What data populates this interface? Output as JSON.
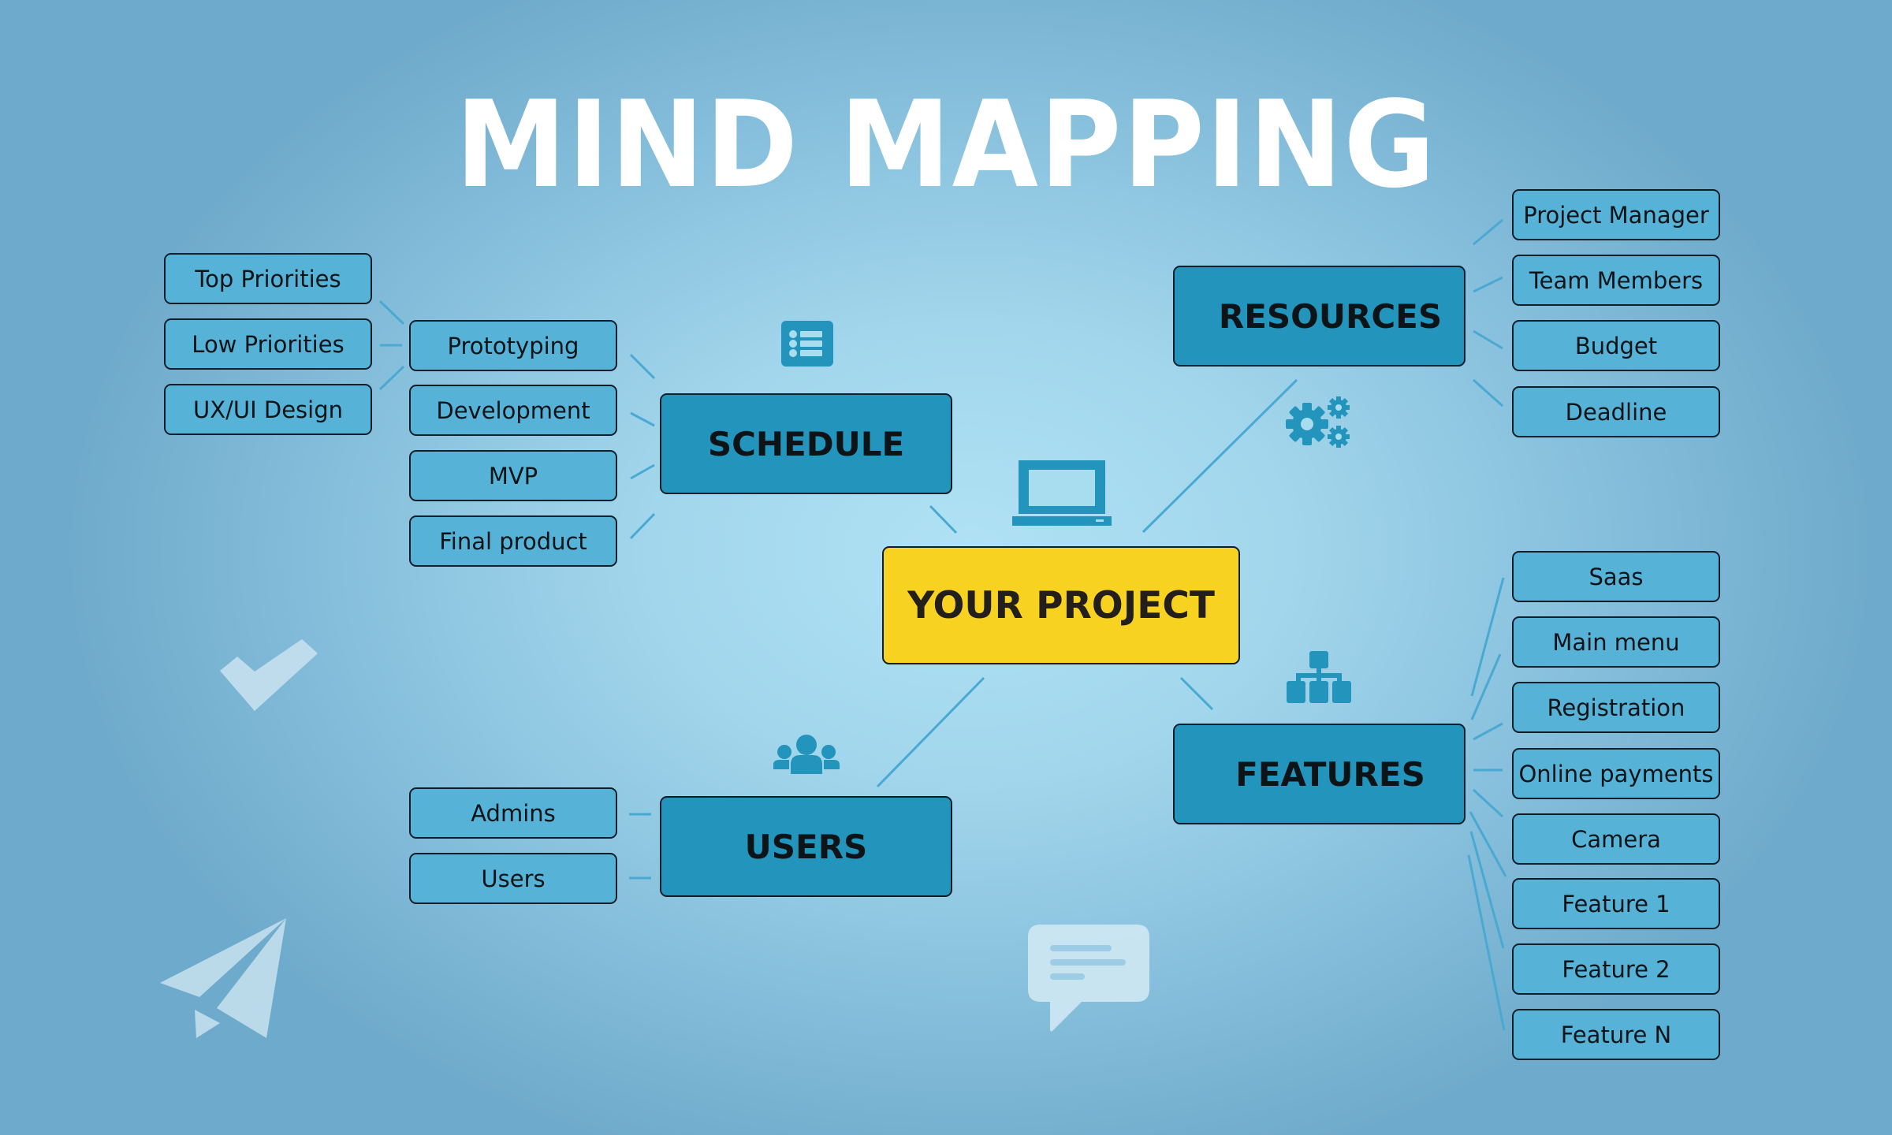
{
  "title": "MIND MAPPING",
  "center": {
    "label": "YOUR PROJECT",
    "color": "#f8d220"
  },
  "colors": {
    "hub": "#2394bb",
    "leaf": "#57b2d7",
    "link": "#4aa9d2",
    "icon": "#2394bb",
    "decor": "#c7e2ef"
  },
  "schedule": {
    "label": "SCHEDULE",
    "icon": "list-icon",
    "children": [
      "Prototyping",
      "Development",
      "MVP",
      "Final product"
    ],
    "prototyping_children": [
      "Top Priorities",
      "Low Priorities",
      "UX/UI Design"
    ]
  },
  "resources": {
    "label": "RESOURCES",
    "icon": "gears-icon",
    "children": [
      "Project Manager",
      "Team Members",
      "Budget",
      "Deadline"
    ]
  },
  "features": {
    "label": "FEATURES",
    "icon": "sitemap-icon",
    "children": [
      "Saas",
      "Main menu",
      "Registration",
      "Online payments",
      "Camera",
      "Feature 1",
      "Feature 2",
      "Feature N"
    ]
  },
  "users": {
    "label": "USERS",
    "icon": "users-group-icon",
    "children": [
      "Admins",
      "Users"
    ]
  },
  "decorations": [
    "laptop-icon",
    "checkmark-icon",
    "paper-plane-icon",
    "chat-bubble-icon"
  ]
}
